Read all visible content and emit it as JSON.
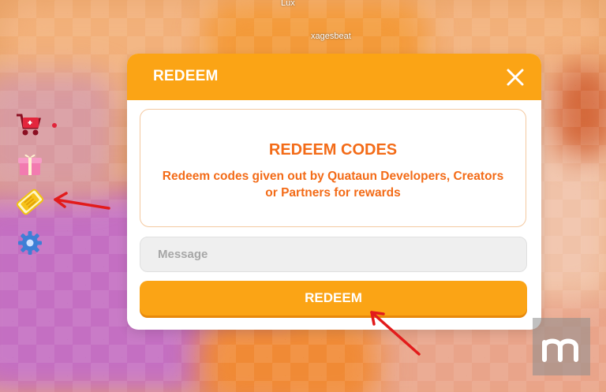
{
  "world": {
    "player_top_label": "Lux",
    "player_name": "xagesbeat"
  },
  "side_menu": [
    {
      "icon": "shop-cart-icon",
      "label": ""
    },
    {
      "icon": "gift-icon",
      "label": ""
    },
    {
      "icon": "code-ticket-icon",
      "label": ""
    },
    {
      "icon": "gear-icon",
      "label": ""
    }
  ],
  "modal": {
    "title": "REDEEM",
    "close_icon": "close-icon",
    "info": {
      "heading": "REDEEM CODES",
      "description": "Redeem codes given out by Quataun Developers, Creators or Partners for rewards"
    },
    "input": {
      "placeholder": "Message",
      "value": ""
    },
    "submit_label": "REDEEM"
  },
  "colors": {
    "header": "#fba415",
    "button": "#fba415",
    "accent_text": "#f36b17",
    "annotation_arrow": "#e21b1b"
  },
  "watermark": {
    "icon": "watermark-m-logo"
  }
}
